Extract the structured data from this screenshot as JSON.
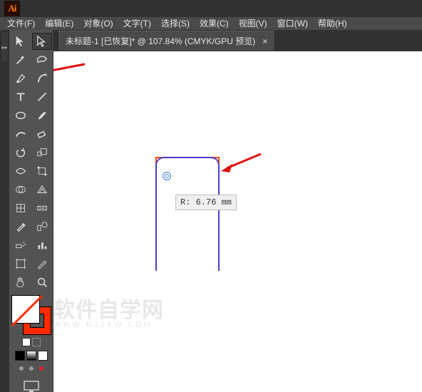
{
  "app": {
    "logo_text": "Ai"
  },
  "menu": {
    "items": [
      {
        "label": "文件(F)"
      },
      {
        "label": "编辑(E)"
      },
      {
        "label": "对象(O)"
      },
      {
        "label": "文字(T)"
      },
      {
        "label": "选择(S)"
      },
      {
        "label": "效果(C)"
      },
      {
        "label": "视图(V)"
      },
      {
        "label": "窗口(W)"
      },
      {
        "label": "帮助(H)"
      }
    ]
  },
  "document_tab": {
    "title": "未标题-1 [已恢复]* @ 107.84% (CMYK/GPU 预览)",
    "close_glyph": "×"
  },
  "gutter": {
    "glyph": "▸▸"
  },
  "canvas": {
    "radius_tip": "R: 6.76 mm",
    "watermark": {
      "big": "软件自学网",
      "small": "WWW.RJZXW.COM"
    }
  },
  "colors": {
    "ui_bg": "#535353",
    "accent": "#ff7c00",
    "stroke_swatch": "#ff2a00",
    "shape_blue": "#4a3ec8",
    "shape_orange": "#ff4e01",
    "arrow_red": "#e20e0e"
  }
}
